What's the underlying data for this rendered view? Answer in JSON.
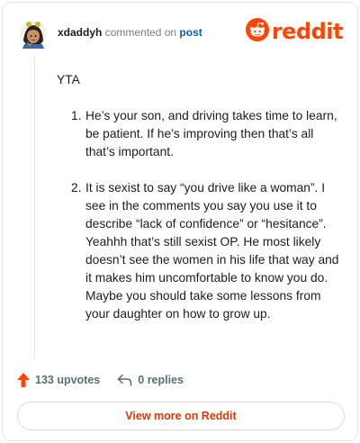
{
  "header": {
    "username": "xdaddyh",
    "action_text": "commented on",
    "target_link": "post",
    "brand": "reddit"
  },
  "comment": {
    "intro": "YTA",
    "items": [
      {
        "number": "1.",
        "text": "He’s your son, and driving takes time to learn, be patient. If he’s improving then that’s all that’s important."
      },
      {
        "number": "2.",
        "text": "It is sexist to say “you drive like a woman”. I see in the comments you say you use it to describe “lack of confidence” or “hesitance”. Yeahhh that’s still sexist OP. He most likely doesn’t see the women in his life that way and it makes him uncomfortable to know you do. Maybe you should take some lessons from your daughter on how to grow up."
      }
    ]
  },
  "actions": {
    "upvotes_label": "133 upvotes",
    "replies_label": "0 replies"
  },
  "footer": {
    "view_more_label": "View more on Reddit"
  },
  "colors": {
    "brand": "#ff4500",
    "link": "#0b5fb0",
    "button_text": "#d93a00",
    "muted": "#576f76"
  },
  "icons": {
    "avatar": "avatar",
    "logo": "reddit-snoo-icon",
    "upvote": "upvote-arrow-icon",
    "reply": "reply-arrow-icon"
  }
}
